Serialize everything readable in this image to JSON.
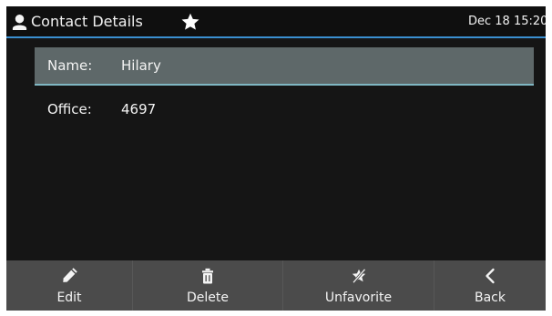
{
  "header": {
    "icon": "user-icon",
    "title": "Contact Details",
    "favorite_icon": "star-icon",
    "datetime": "Dec 18 15:20"
  },
  "contact": {
    "fields": [
      {
        "label": "Name:",
        "value": "Hilary",
        "selected": true
      },
      {
        "label": "Office:",
        "value": "4697",
        "selected": false
      }
    ]
  },
  "softkeys": [
    {
      "label": "Edit",
      "icon": "pencil-icon"
    },
    {
      "label": "Delete",
      "icon": "trash-icon"
    },
    {
      "label": "Unfavorite",
      "icon": "unfavorite-star-icon"
    },
    {
      "label": "Back",
      "icon": "chevron-left-icon"
    }
  ],
  "colors": {
    "header_background": "#0f0f0f",
    "header_accent": "#3a8fd0",
    "content_background": "#151515",
    "selected_row": "#5e6869",
    "selected_row_accent": "#7fb6c2",
    "softkey_bar": "#4b4b4b",
    "text": "#f4f4f4"
  }
}
